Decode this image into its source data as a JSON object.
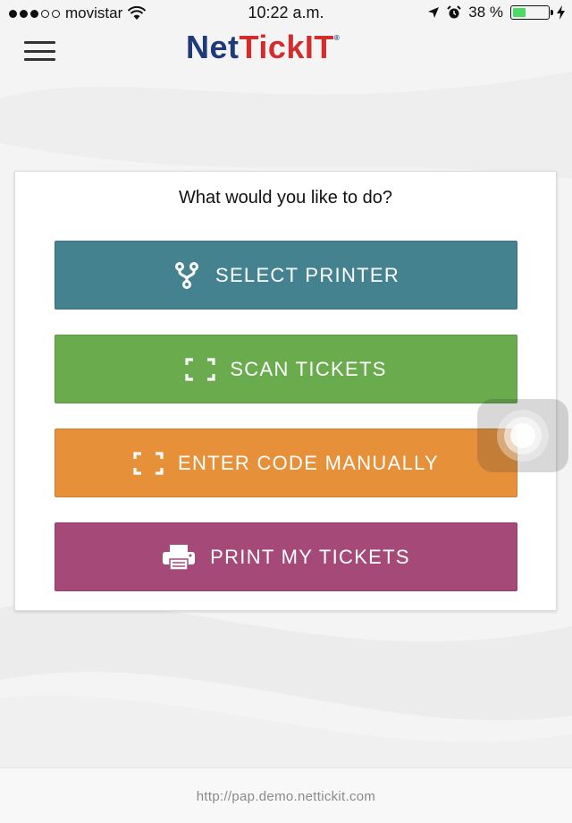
{
  "status_bar": {
    "carrier": "movistar",
    "time": "10:22 a.m.",
    "battery_percent": "38 %",
    "battery_level": 0.38,
    "signal_bars_filled": 3,
    "signal_bars_total": 5
  },
  "header": {
    "logo_part1": "Net",
    "logo_part2": "TickIT",
    "logo_mark": "®",
    "menu_icon": "hamburger-icon"
  },
  "card": {
    "title": "What would you like to do?",
    "buttons": [
      {
        "label": "SELECT PRINTER",
        "icon": "fork-icon",
        "color": "#458290"
      },
      {
        "label": "SCAN TICKETS",
        "icon": "scan-frame-icon",
        "color": "#6aab4e"
      },
      {
        "label": "ENTER CODE MANUALLY",
        "icon": "scan-frame-icon",
        "color": "#e6913a"
      },
      {
        "label": "PRINT MY TICKETS",
        "icon": "printer-icon",
        "color": "#a54a78"
      }
    ]
  },
  "footer": {
    "url": "http://pap.demo.nettickit.com"
  },
  "colors": {
    "logo_blue": "#1f3a7a",
    "logo_red": "#d22c2c"
  }
}
